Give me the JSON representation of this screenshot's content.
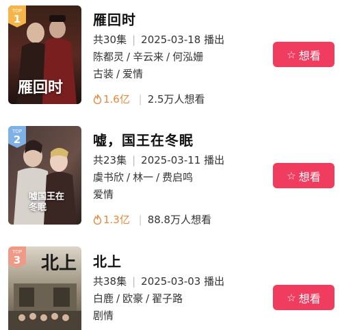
{
  "items": [
    {
      "rank_top": "TOP",
      "rank_num": "1",
      "rank_color": "#f4b64a",
      "poster_title": "雁回时",
      "title": "雁回时",
      "episodes": "共30集",
      "date_label": "2025-03-18 播出",
      "cast": [
        "陈都灵",
        "辛云来",
        "何泓姗"
      ],
      "tags": [
        "古装",
        "爱情"
      ],
      "heat": "1.6亿",
      "want_count": "2.5万人想看",
      "button_label": "想看"
    },
    {
      "rank_top": "TOP",
      "rank_num": "2",
      "rank_color": "#7fb0e6",
      "poster_title": "嘘国王在冬眠",
      "title": "嘘，国王在冬眠",
      "episodes": "共23集",
      "date_label": "2025-03-11 播出",
      "cast": [
        "虞书欣",
        "林一",
        "费启鸣"
      ],
      "tags": [
        "爱情"
      ],
      "heat": "1.3亿",
      "want_count": "88.8万人想看",
      "button_label": "想看"
    },
    {
      "rank_top": "TOP",
      "rank_num": "3",
      "rank_color": "#ef9a86",
      "poster_title": "北上",
      "title": "北上",
      "episodes": "共38集",
      "date_label": "2025-03-03 播出",
      "cast": [
        "白鹿",
        "欧豪",
        "翟子路"
      ],
      "tags": [
        "剧情"
      ],
      "heat": "",
      "want_count": "",
      "button_label": "想看"
    }
  ],
  "colors": {
    "accent": "#f03c5f",
    "heat": "#e8863c"
  }
}
